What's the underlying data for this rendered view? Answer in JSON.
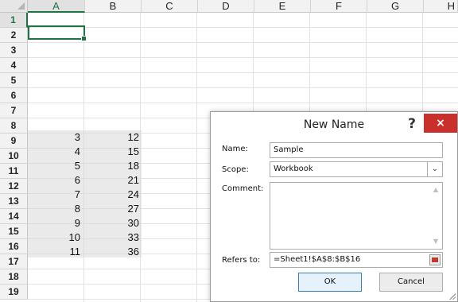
{
  "columns": [
    "A",
    "B",
    "C",
    "D",
    "E",
    "F",
    "G",
    "H"
  ],
  "rows": [
    "1",
    "2",
    "3",
    "4",
    "5",
    "6",
    "7",
    "8",
    "9",
    "10",
    "11",
    "12",
    "13",
    "14",
    "15",
    "16",
    "17",
    "18",
    "19"
  ],
  "selected_column": "A",
  "selected_row": "1",
  "col_a_values": [
    "3",
    "4",
    "5",
    "6",
    "7",
    "8",
    "9",
    "10",
    "11"
  ],
  "col_b_values": [
    "12",
    "15",
    "18",
    "21",
    "24",
    "27",
    "30",
    "33",
    "36"
  ],
  "dialog": {
    "title": "New Name",
    "help_label": "?",
    "close_label": "×",
    "name_label": "Name:",
    "name_value": "Sample",
    "scope_label": "Scope:",
    "scope_value": "Workbook",
    "comment_label": "Comment:",
    "comment_value": "",
    "refers_label": "Refers to:",
    "refers_value": "=Sheet1!$A$8:$B$16",
    "ok_label": "OK",
    "cancel_label": "Cancel"
  },
  "icons": {
    "dropdown": "chevron-down-icon",
    "ref_collapse": "collapse-dialog-icon",
    "scroll_up": "scroll-up-icon",
    "scroll_down": "scroll-down-icon"
  },
  "colors": {
    "selection_green": "#217346",
    "close_red": "#c9302c",
    "data_fill": "#d9d9d9"
  }
}
